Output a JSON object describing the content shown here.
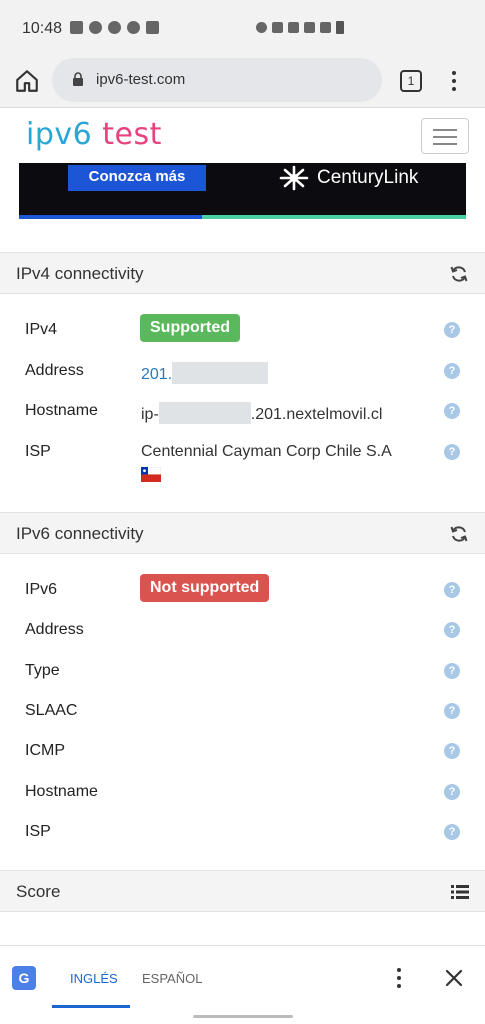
{
  "status_bar": {
    "time": "10:48"
  },
  "browser": {
    "url": "ipv6-test.com",
    "tab_count": "1"
  },
  "site": {
    "logo_part1": "ipv6",
    "logo_part2": "test"
  },
  "ad": {
    "cta": "Conozca más",
    "brand": "CenturyLink"
  },
  "ipv4": {
    "title": "IPv4 connectivity",
    "rows": [
      {
        "label": "IPv4",
        "value": "Supported"
      },
      {
        "label": "Address",
        "value_prefix": "201."
      },
      {
        "label": "Hostname",
        "value_prefix": "ip-",
        "value_suffix": ".201.nextelmovil.cl"
      },
      {
        "label": "ISP",
        "value": "Centennial Cayman Corp Chile S.A"
      }
    ]
  },
  "ipv6": {
    "title": "IPv6 connectivity",
    "rows": [
      {
        "label": "IPv6",
        "value": "Not supported"
      },
      {
        "label": "Address"
      },
      {
        "label": "Type"
      },
      {
        "label": "SLAAC"
      },
      {
        "label": "ICMP"
      },
      {
        "label": "Hostname"
      },
      {
        "label": "ISP"
      }
    ]
  },
  "score": {
    "title": "Score"
  },
  "translate": {
    "lang_from": "INGLÉS",
    "lang_to": "ESPAÑOL"
  },
  "colors": {
    "supported": "#5cb85c",
    "not_supported": "#d9534f",
    "link": "#2a7ab8",
    "logo_blue": "#2aa6d6",
    "logo_pink": "#e8437e"
  }
}
